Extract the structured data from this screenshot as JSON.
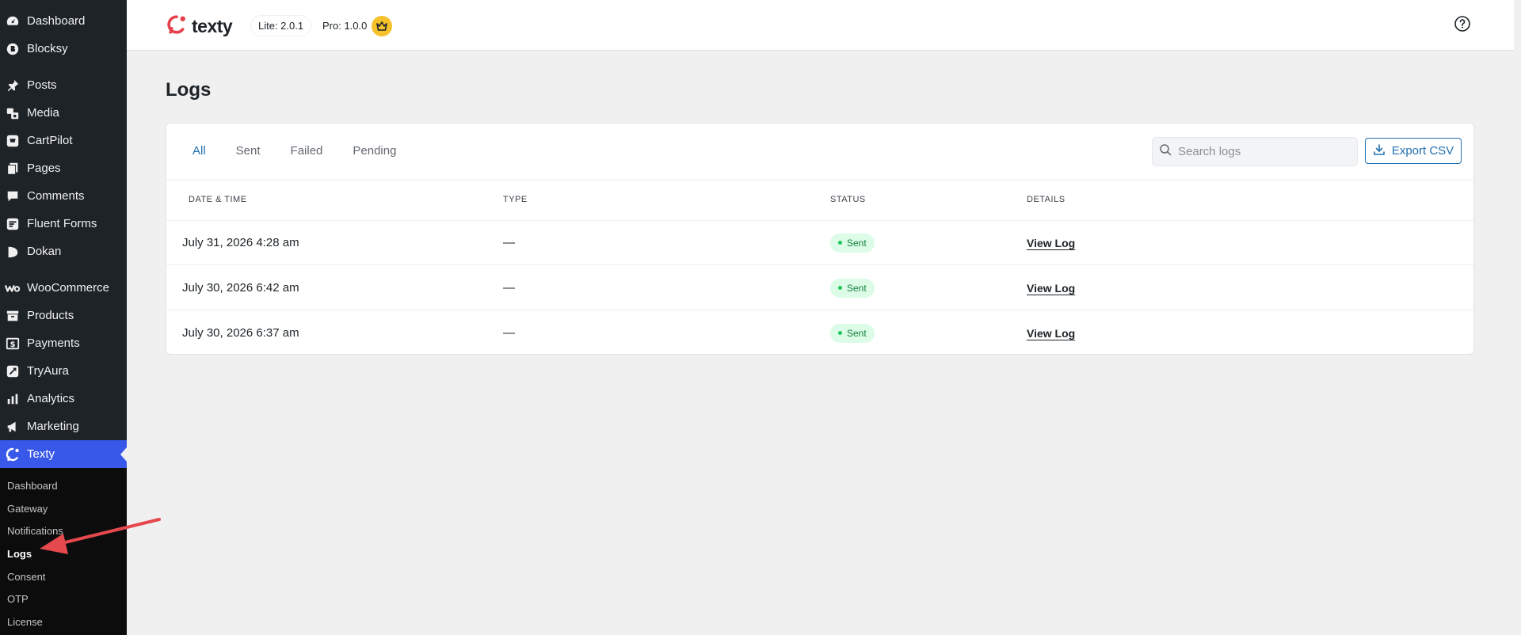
{
  "sidebar": {
    "items": [
      {
        "label": "Dashboard",
        "icon": "gauge-icon"
      },
      {
        "label": "Blocksy",
        "icon": "blocksy-icon"
      },
      {
        "label": "Posts",
        "icon": "pin-icon"
      },
      {
        "label": "Media",
        "icon": "media-icon"
      },
      {
        "label": "CartPilot",
        "icon": "cartpilot-icon"
      },
      {
        "label": "Pages",
        "icon": "pages-icon"
      },
      {
        "label": "Comments",
        "icon": "comment-icon"
      },
      {
        "label": "Fluent Forms",
        "icon": "fluent-forms-icon"
      },
      {
        "label": "Dokan",
        "icon": "dokan-icon"
      },
      {
        "label": "WooCommerce",
        "icon": "woo-icon"
      },
      {
        "label": "Products",
        "icon": "archive-icon"
      },
      {
        "label": "Payments",
        "icon": "dollar-icon"
      },
      {
        "label": "TryAura",
        "icon": "tryaura-icon"
      },
      {
        "label": "Analytics",
        "icon": "bar-chart-icon"
      },
      {
        "label": "Marketing",
        "icon": "megaphone-icon"
      },
      {
        "label": "Texty",
        "icon": "texty-icon"
      }
    ],
    "submenu": [
      {
        "label": "Dashboard"
      },
      {
        "label": "Gateway"
      },
      {
        "label": "Notifications"
      },
      {
        "label": "Logs"
      },
      {
        "label": "Consent"
      },
      {
        "label": "OTP"
      },
      {
        "label": "License"
      }
    ]
  },
  "topbar": {
    "brand": "texty",
    "lite_version": "Lite: 2.0.1",
    "pro_version": "Pro: 1.0.0"
  },
  "page": {
    "title": "Logs",
    "tabs": [
      {
        "label": "All",
        "active": true
      },
      {
        "label": "Sent",
        "active": false
      },
      {
        "label": "Failed",
        "active": false
      },
      {
        "label": "Pending",
        "active": false
      }
    ],
    "search_placeholder": "Search logs",
    "export_label": "Export CSV",
    "columns": [
      "DATE & TIME",
      "TYPE",
      "STATUS",
      "DETAILS"
    ],
    "rows": [
      {
        "date": "July 31, 2026 4:28 am",
        "type": "—",
        "status": "Sent",
        "details": "View Log"
      },
      {
        "date": "July 30, 2026 6:42 am",
        "type": "—",
        "status": "Sent",
        "details": "View Log"
      },
      {
        "date": "July 30, 2026 6:37 am",
        "type": "—",
        "status": "Sent",
        "details": "View Log"
      }
    ]
  },
  "colors": {
    "sidebar_bg": "#1d2327",
    "active_menu": "#3858e9",
    "accent_blue": "#2271b1",
    "brand_red": "#e5424d",
    "crown_yellow": "#f5c22b",
    "sent_green": "#15803d",
    "sent_bg": "#dcfce7",
    "annotation_arrow": "#e5484d"
  }
}
